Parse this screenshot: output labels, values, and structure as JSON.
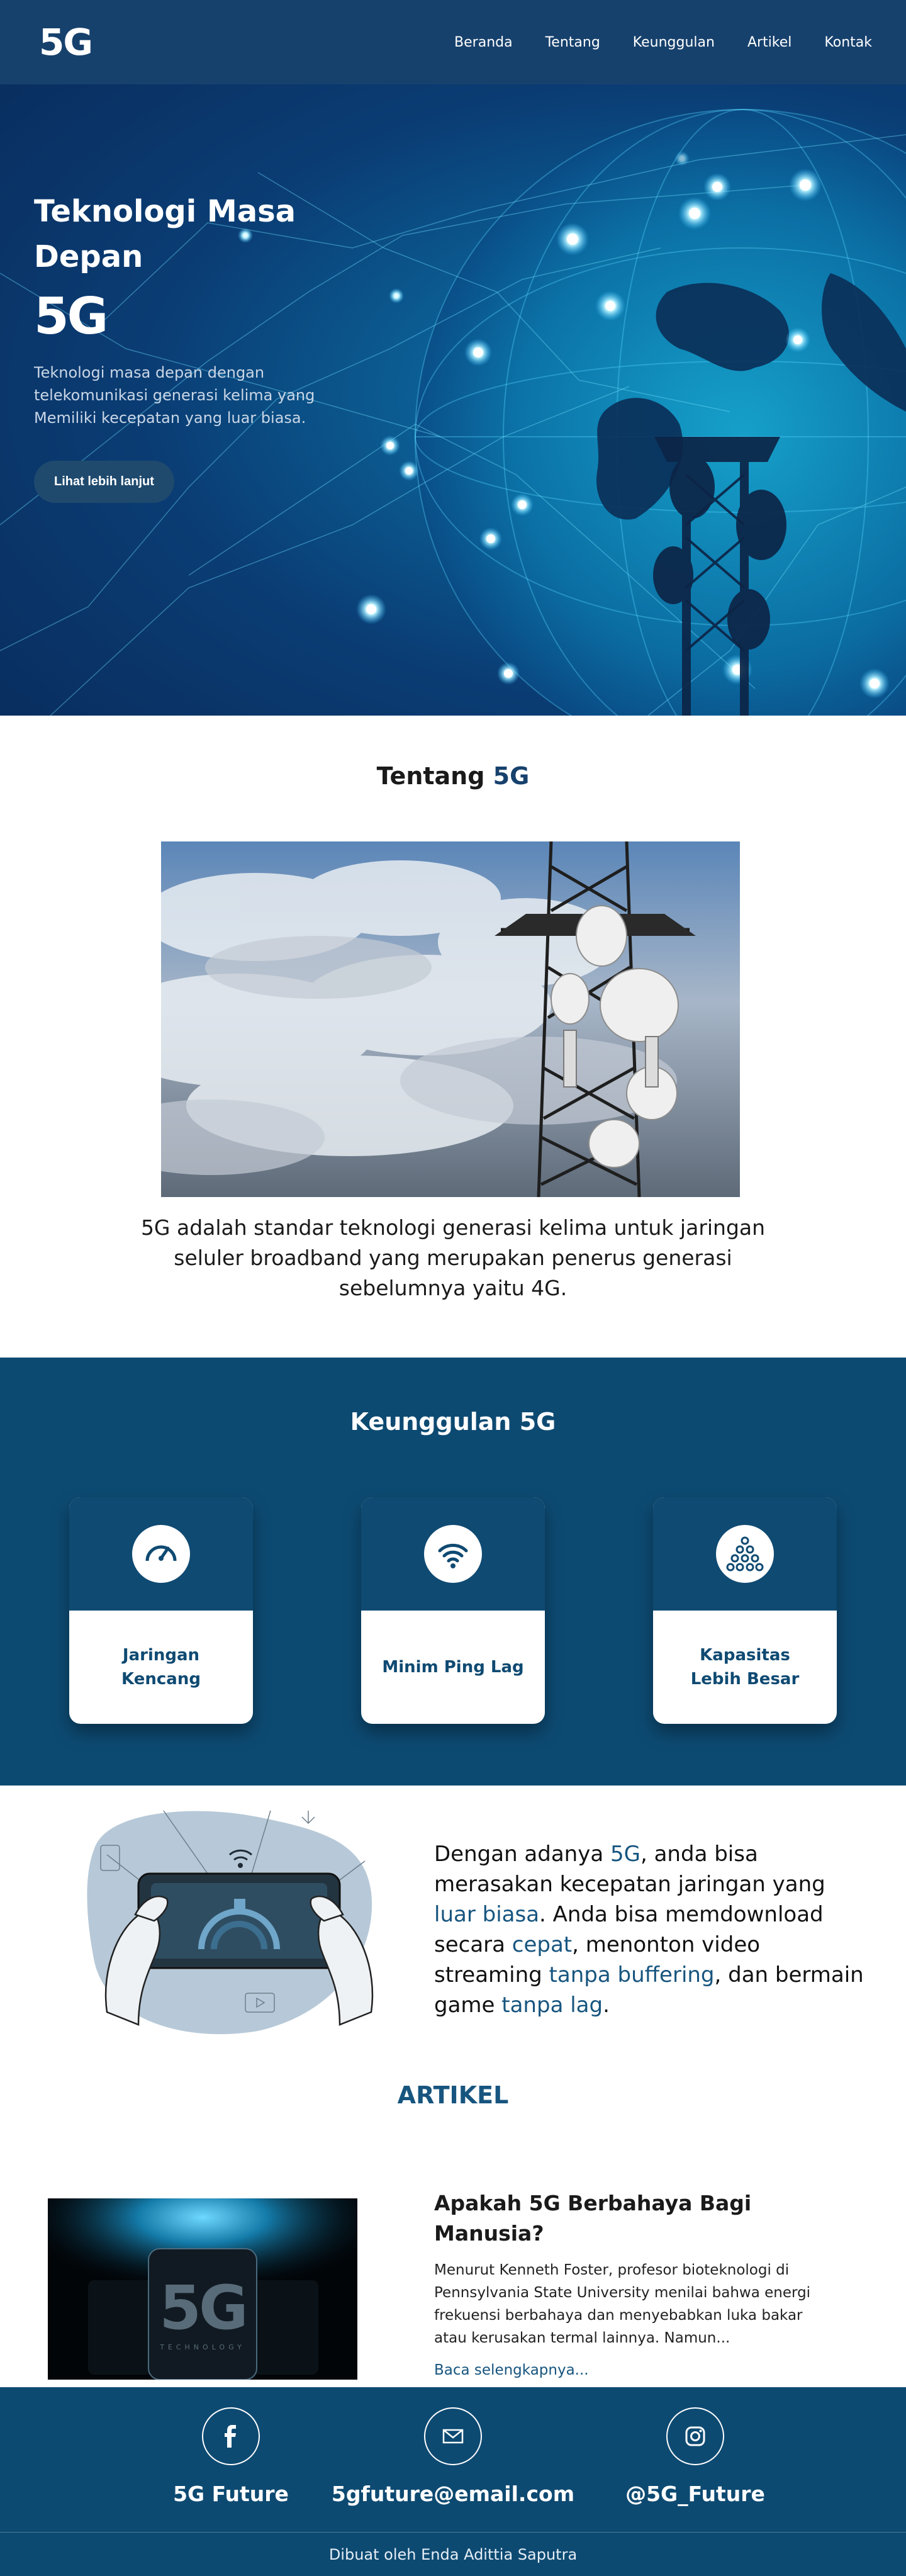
{
  "nav": {
    "logo": "5G",
    "items": [
      "Beranda",
      "Tentang",
      "Keunggulan",
      "Artikel",
      "Kontak"
    ]
  },
  "hero": {
    "title": "Teknologi Masa Depan",
    "big": "5G",
    "description": "Teknologi masa depan dengan telekomunikasi generasi kelima yang Memiliki kecepatan yang luar biasa.",
    "button": "Lihat lebih lanjut"
  },
  "tentang": {
    "title_main": "Tentang",
    "title_accent": "5G",
    "description": "5G adalah standar teknologi generasi kelima untuk jaringan seluler broadband yang merupakan penerus generasi sebelumnya yaitu 4G."
  },
  "keunggulan": {
    "title": "Keunggulan 5G",
    "cards": [
      {
        "label": "Jaringan Kencang",
        "icon": "speedometer-icon"
      },
      {
        "label": "Minim Ping Lag",
        "icon": "signal-icon"
      },
      {
        "label": "Kapasitas Lebih Besar",
        "icon": "network-pyramid-icon"
      }
    ]
  },
  "promo": {
    "t1": "Dengan adanya ",
    "h1": "5G",
    "t2": ", anda bisa merasakan kecepatan jaringan yang ",
    "h2": "luar biasa",
    "t3": ". Anda bisa memdownload secara ",
    "h3": "cepat",
    "t4": ", menonton video streaming ",
    "h4": "tanpa buffering",
    "t5": ", dan bermain game ",
    "h5": "tanpa lag",
    "t6": "."
  },
  "artikel": {
    "title": "ARTIKEL",
    "image_text": "5G",
    "image_subtext": "TECHNOLOGY",
    "post_title": "Apakah 5G Berbahaya Bagi Manusia?",
    "post_excerpt": "Menurut Kenneth Foster, profesor bioteknologi di Pennsylvania State University menilai bahwa energi frekuensi berbahaya dan menyebabkan luka bakar atau kerusakan termal lainnya. Namun...",
    "read_more": "Baca selengkapnya..."
  },
  "footer": {
    "items": [
      {
        "label": "5G Future",
        "icon": "facebook-icon"
      },
      {
        "label": "5gfuture@email.com",
        "icon": "mail-icon"
      },
      {
        "label": "@5G_Future",
        "icon": "instagram-icon"
      }
    ],
    "credit": "Dibuat oleh Enda Adittia Saputra"
  },
  "colors": {
    "primary": "#17416d",
    "section": "#0d4a72",
    "accent": "#17557f"
  }
}
